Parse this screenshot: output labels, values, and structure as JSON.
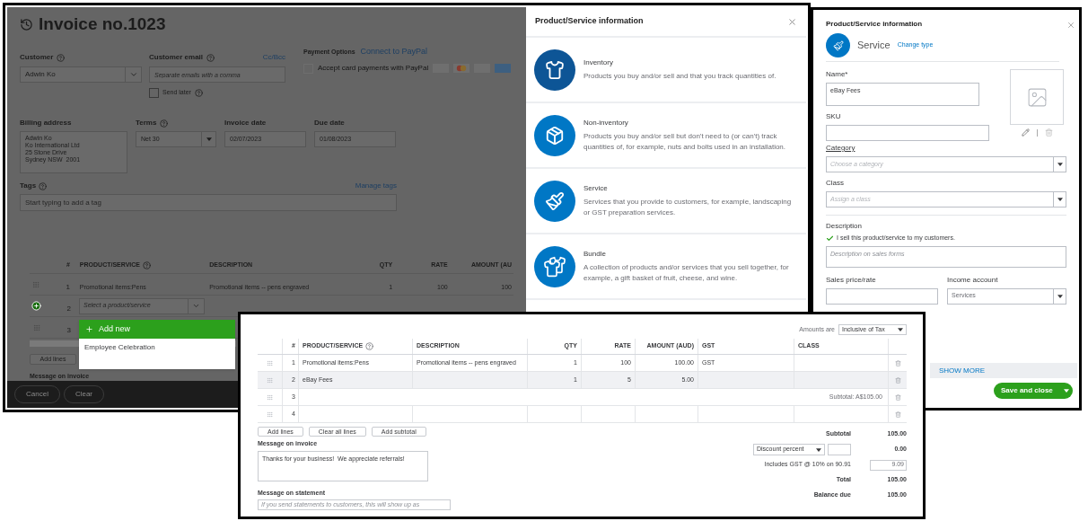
{
  "invoice_window": {
    "title": "Invoice no.1023",
    "customer": {
      "label": "Customer",
      "value": "Adwin Ko"
    },
    "customer_email": {
      "label": "Customer email",
      "link": "Cc/Bcc",
      "placeholder": "Separate emails with a comma"
    },
    "send_later": {
      "label": "Send later",
      "checked": false
    },
    "payment_options": {
      "label": "Payment Options",
      "link": "Connect to PayPal",
      "accept_label": "Accept card payments with PayPal",
      "checked": false,
      "disabled": true
    },
    "billing_address": {
      "label": "Billing address",
      "lines": [
        "Adwin Ko",
        "Ko International Ltd",
        "25 Stone Drive",
        "Sydney NSW  2001"
      ]
    },
    "terms": {
      "label": "Terms",
      "value": "Net 30"
    },
    "invoice_date": {
      "label": "Invoice date",
      "value": "02/07/2023"
    },
    "due_date": {
      "label": "Due date",
      "value": "01/08/2023"
    },
    "tags": {
      "label": "Tags",
      "link": "Manage tags",
      "placeholder": "Start typing to add a tag"
    },
    "table": {
      "columns": [
        "#",
        "PRODUCT/SERVICE",
        "DESCRIPTION",
        "QTY",
        "RATE",
        "AMOUNT (AU"
      ],
      "rows": [
        {
          "kind": "item",
          "number": "1",
          "product": "Promotional items:Pens",
          "description": "Promotional items -- pens engraved",
          "qty": "1",
          "rate": "100",
          "amount": "100"
        },
        {
          "kind": "editing",
          "number": "2",
          "placeholder": "Select a product/service"
        },
        {
          "kind": "empty",
          "number": "3"
        }
      ]
    },
    "dropdown": {
      "add_new": "Add new",
      "items": [
        "Employee Celebration"
      ]
    },
    "add_lines": "Add lines",
    "message_label": "Message on invoice",
    "footer_buttons": [
      "Cancel",
      "Clear"
    ]
  },
  "type_modal": {
    "title": "Product/Service information",
    "types": [
      {
        "kind": "inventory",
        "name": "Inventory",
        "description": "Products you buy and/or sell and that you track quantities of."
      },
      {
        "kind": "non_inventory",
        "name": "Non-inventory",
        "description": "Products you buy and/or sell but don't need to (or can't) track quantities of, for example, nuts and bolts used in an installation."
      },
      {
        "kind": "service",
        "name": "Service",
        "description": "Services that you provide to customers, for example, landscaping or GST preparation services."
      },
      {
        "kind": "bundle",
        "name": "Bundle",
        "description": "A collection of products and/or services that you sell together, for example, a gift basket of fruit, cheese, and wine."
      }
    ]
  },
  "item_panel": {
    "title": "Product/Service information",
    "type": "Service",
    "change_type": "Change type",
    "name": {
      "label": "Name*",
      "value": "eBay Fees"
    },
    "sku": {
      "label": "SKU"
    },
    "category": {
      "label": "Category",
      "placeholder": "Choose a category"
    },
    "class": {
      "label": "Class",
      "placeholder": "Assign a class"
    },
    "description": {
      "label": "Description",
      "sell_label": "I sell this product/service to my customers.",
      "checked": true,
      "placeholder": "Description on sales forms"
    },
    "sales_price": {
      "label": "Sales price/rate"
    },
    "income_account": {
      "label": "Income account",
      "value": "Services"
    },
    "show_more": "SHOW MORE",
    "save_button": "Save and close"
  },
  "invoice_detail": {
    "amounts_label": "Amounts are",
    "amounts_value": "Inclusive of Tax",
    "columns": [
      "#",
      "PRODUCT/SERVICE",
      "DESCRIPTION",
      "QTY",
      "RATE",
      "AMOUNT (AUD)",
      "GST",
      "CLASS"
    ],
    "rows": [
      {
        "kind": "item",
        "selected": false,
        "number": "1",
        "product": "Promotional items:Pens",
        "description": "Promotional items -- pens engraved",
        "qty": "1",
        "rate": "100",
        "amount": "100.00",
        "gst": "GST"
      },
      {
        "kind": "item",
        "selected": true,
        "number": "2",
        "product": "eBay Fees",
        "qty": "1",
        "rate": "5",
        "amount": "5.00"
      },
      {
        "kind": "subtotal",
        "selected": false,
        "number": "3",
        "text": "Subtotal: A$105.00"
      },
      {
        "kind": "empty",
        "selected": false,
        "number": "4"
      }
    ],
    "buttons": [
      "Add lines",
      "Clear all lines",
      "Add subtotal"
    ],
    "message_invoice": {
      "label": "Message on invoice",
      "value": "Thanks for your business!  We appreciate referrals!"
    },
    "message_statement": {
      "label": "Message on statement",
      "placeholder": "If you send statements to customers, this will show up as"
    },
    "subtotal": {
      "label": "Subtotal",
      "value": "105.00"
    },
    "discount": {
      "type": "Discount percent",
      "value": "0.00"
    },
    "gst": {
      "label": "Includes GST @ 10% on 90.91",
      "value": "9.09"
    },
    "total": {
      "label": "Total",
      "value": "105.00"
    },
    "balance_due": {
      "label": "Balance due",
      "value": "105.00"
    }
  }
}
